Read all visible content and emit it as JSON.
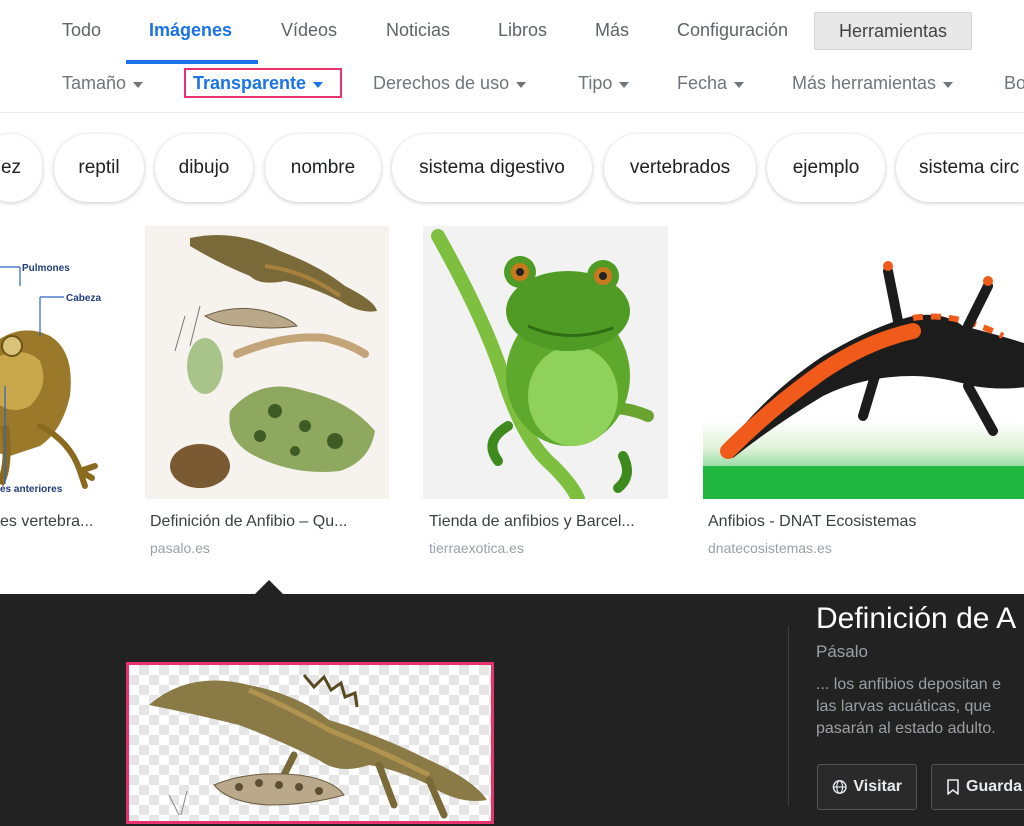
{
  "tabs": {
    "todo": "Todo",
    "imagenes": "Imágenes",
    "videos": "Vídeos",
    "noticias": "Noticias",
    "libros": "Libros",
    "mas": "Más",
    "configuracion": "Configuración",
    "herramientas": "Herramientas"
  },
  "filters": {
    "tamano": "Tamaño",
    "transparente": "Transparente",
    "derechos": "Derechos de uso",
    "tipo": "Tipo",
    "fecha": "Fecha",
    "mas_herramientas": "Más herramientas",
    "cut": "Bo"
  },
  "chips": [
    "ez",
    "reptil",
    "dibujo",
    "nombre",
    "sistema digestivo",
    "vertebrados",
    "ejemplo",
    "sistema circ"
  ],
  "results": [
    {
      "caption": "es vertebra...",
      "source": "",
      "labels": [
        "Pulmones",
        "Cabeza",
        "es anteriores"
      ]
    },
    {
      "caption": "Definición de Anfibio – Qu...",
      "source": "pasalo.es"
    },
    {
      "caption": "Tienda de anfibios y Barcel...",
      "source": "tierraexotica.es"
    },
    {
      "caption": "Anfibios - DNAT Ecosistemas",
      "source": "dnatecosistemas.es"
    }
  ],
  "panel": {
    "title": "Definición de A",
    "site": "Pásalo",
    "desc_lines": [
      "... los anfibios depositan e",
      "las larvas acuáticas, que",
      "pasarán al estado adulto."
    ],
    "visit": "Visitar",
    "save": "Guarda"
  },
  "colors": {
    "accent": "#1a73e8",
    "highlight": "#e8336d",
    "panel_bg": "#222222"
  },
  "icons": {
    "visit": "globe-icon",
    "save": "bookmark-icon"
  }
}
